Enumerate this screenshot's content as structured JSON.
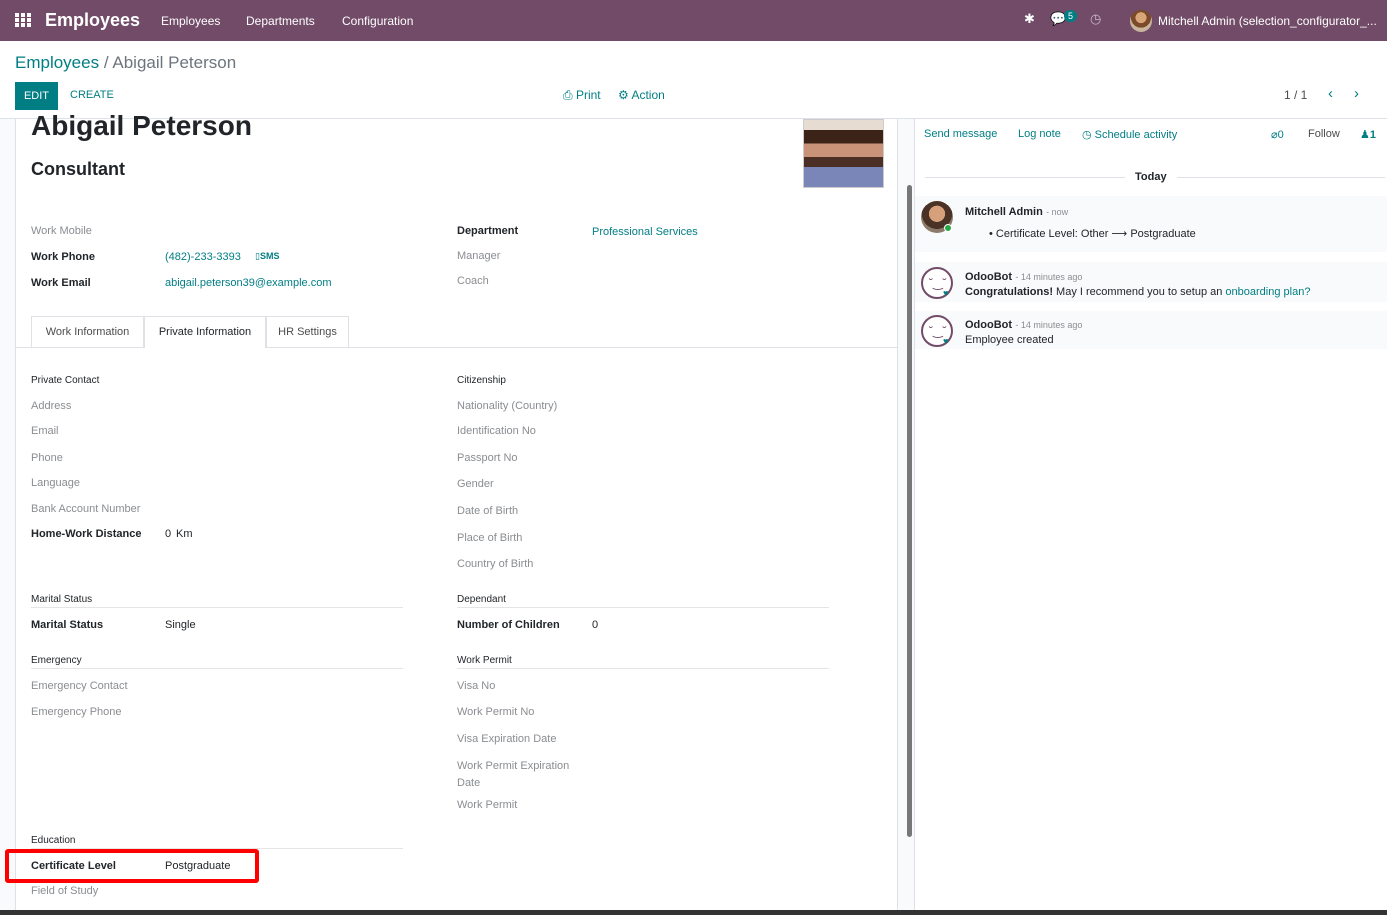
{
  "navbar": {
    "app_title": "Employees",
    "menu": [
      "Employees",
      "Departments",
      "Configuration"
    ],
    "messages_count": "5",
    "user": "Mitchell Admin (selection_configurator_..."
  },
  "control_panel": {
    "breadcrumb_parent": "Employees",
    "breadcrumb_sep": "/",
    "breadcrumb_current": "Abigail Peterson",
    "edit_label": "EDIT",
    "create_label": "CREATE",
    "print_label": "Print",
    "action_label": "Action",
    "pager": "1 / 1"
  },
  "employee": {
    "name": "Abigail Peterson",
    "job_title": "Consultant",
    "work_mobile_label": "Work Mobile",
    "work_phone_label": "Work Phone",
    "work_phone": "(482)-233-3393",
    "sms_label": "SMS",
    "work_email_label": "Work Email",
    "work_email": "abigail.peterson39@example.com",
    "department_label": "Department",
    "department": "Professional Services",
    "manager_label": "Manager",
    "coach_label": "Coach"
  },
  "tabs": [
    "Work Information",
    "Private Information",
    "HR Settings"
  ],
  "private": {
    "private_contact": "Private Contact",
    "address": "Address",
    "email": "Email",
    "phone": "Phone",
    "language": "Language",
    "bank": "Bank Account Number",
    "home_work_distance_label": "Home-Work Distance",
    "home_work_distance": "0",
    "km": "Km",
    "citizenship": "Citizenship",
    "nationality": "Nationality (Country)",
    "identification": "Identification No",
    "passport": "Passport No",
    "gender": "Gender",
    "dob": "Date of Birth",
    "pob": "Place of Birth",
    "cob": "Country of Birth",
    "marital_status_section": "Marital Status",
    "marital_status_label": "Marital Status",
    "marital_status": "Single",
    "dependant": "Dependant",
    "children_label": "Number of Children",
    "children": "0",
    "emergency": "Emergency",
    "emergency_contact": "Emergency Contact",
    "emergency_phone": "Emergency Phone",
    "work_permit_section": "Work Permit",
    "visa_no": "Visa No",
    "work_permit_no": "Work Permit No",
    "visa_exp": "Visa Expiration Date",
    "wp_exp_1": "Work Permit Expiration",
    "wp_exp_2": "Date",
    "work_permit": "Work Permit",
    "education": "Education",
    "certificate_label": "Certificate Level",
    "certificate": "Postgraduate",
    "field_of_study": "Field of Study"
  },
  "chatter": {
    "send_message": "Send message",
    "log_note": "Log note",
    "schedule_activity": "Schedule activity",
    "attachments": "0",
    "follow": "Follow",
    "followers": "1",
    "today": "Today",
    "messages": [
      {
        "author": "Mitchell Admin",
        "time": "- now",
        "body_prefix": "Certificate Level: Other",
        "arrow": "⟶",
        "body_suffix": "Postgraduate"
      },
      {
        "author": "OdooBot",
        "time": "- 14 minutes ago",
        "body_bold": "Congratulations!",
        "body": " May I recommend you to setup an ",
        "link": "onboarding plan?"
      },
      {
        "author": "OdooBot",
        "time": "- 14 minutes ago",
        "body": "Employee created"
      }
    ]
  }
}
